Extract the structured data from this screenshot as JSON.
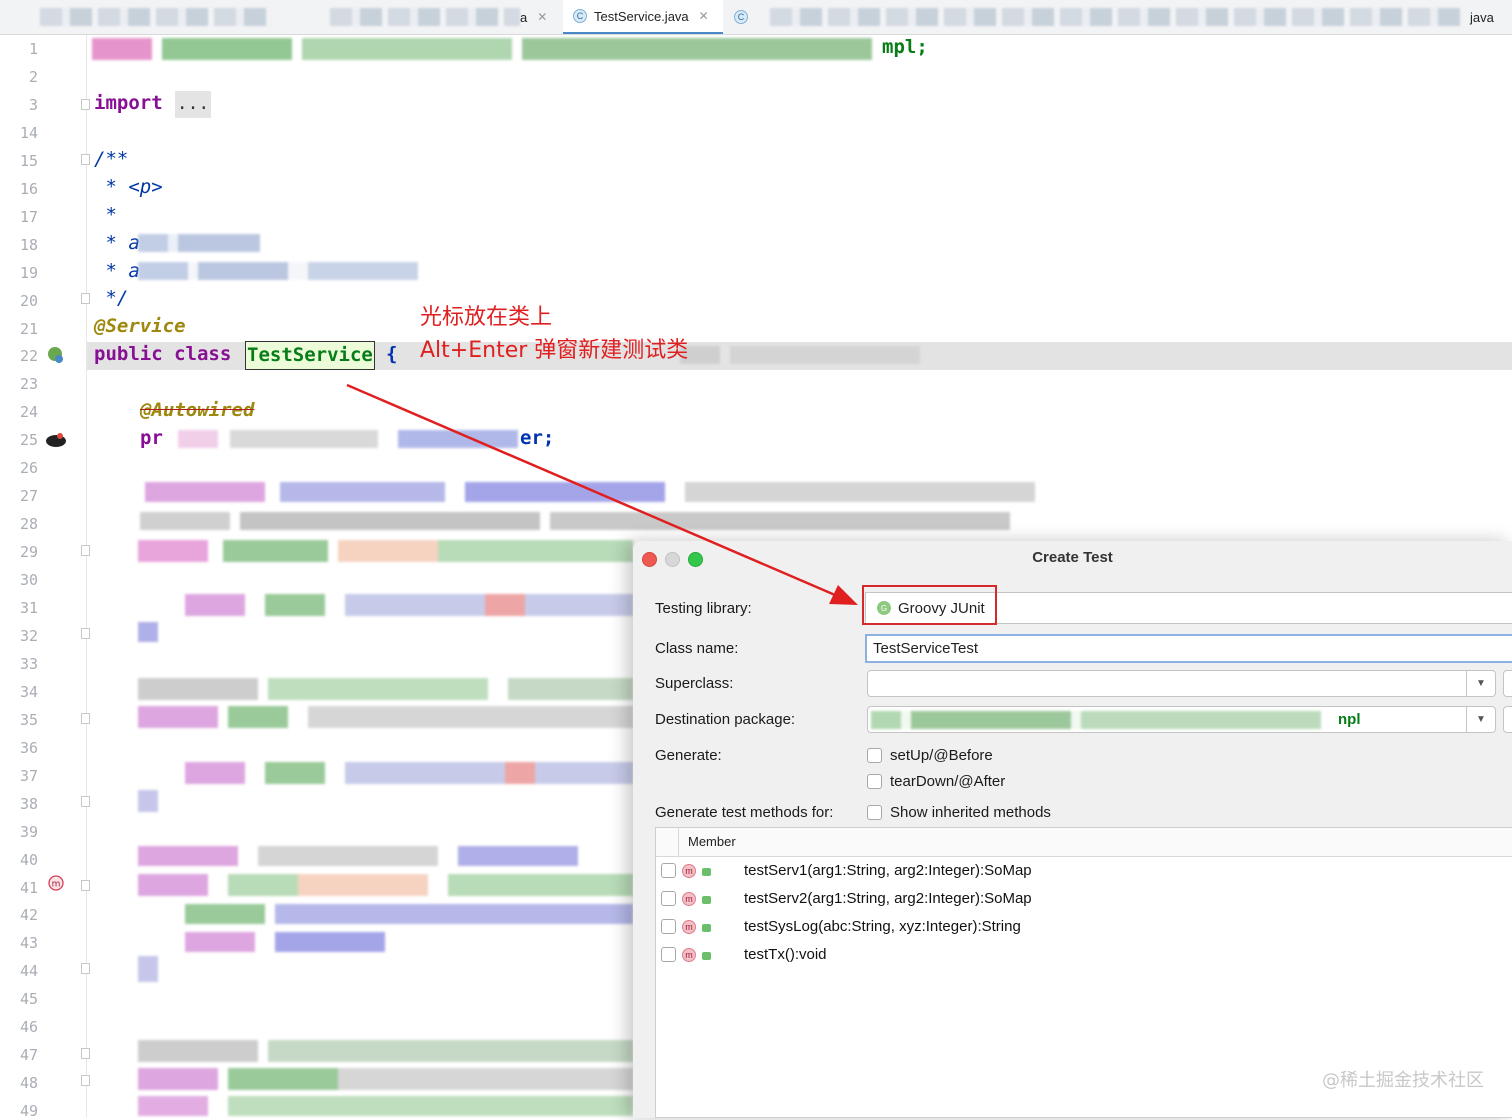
{
  "tabs": [
    {
      "label": "TestService.java",
      "icon": "class-icon",
      "active": true
    },
    {
      "label": "java",
      "icon": "class-icon",
      "active": false
    }
  ],
  "tab_fragment_left": "a",
  "line_numbers": [
    "1",
    "2",
    "3",
    "14",
    "15",
    "16",
    "17",
    "18",
    "19",
    "20",
    "21",
    "22",
    "23",
    "24",
    "25",
    "26",
    "27",
    "28",
    "29",
    "30",
    "31",
    "32",
    "33",
    "34",
    "35",
    "36",
    "37",
    "38",
    "39",
    "40",
    "41",
    "42",
    "43",
    "44",
    "45",
    "46",
    "47",
    "48",
    "49"
  ],
  "code": {
    "line1_tail": "mpl;",
    "import_kw": "import",
    "import_folded": "...",
    "doc_open": "/**",
    "doc_p_star": " * ",
    "doc_p_tag": "<p>",
    "doc_star": " *",
    "doc_star_a": " * a",
    "doc_close": " */",
    "annotation_service": "@Service",
    "decl_public": "public",
    "decl_class": "class",
    "class_name": "TestService",
    "brace": "{",
    "autowired": "@Autowired",
    "field_prefix": "pr",
    "field_suffix": "er;"
  },
  "notes": {
    "line1": "光标放在类上",
    "line2": "Alt+Enter 弹窗新建测试类"
  },
  "dialog": {
    "title": "Create Test",
    "testing_library_label": "Testing library:",
    "testing_library_value": "Groovy JUnit",
    "class_name_label": "Class name:",
    "class_name_value": "TestServiceTest",
    "superclass_label": "Superclass:",
    "superclass_value": "",
    "destination_label": "Destination package:",
    "destination_value_tail": "npl",
    "generate_label": "Generate:",
    "generate_options": [
      "setUp/@Before",
      "tearDown/@After"
    ],
    "methods_for_label": "Generate test methods for:",
    "show_inherited_label": "Show inherited methods",
    "member_header": "Member",
    "members": [
      "testServ1(arg1:String, arg2:Integer):SoMap",
      "testServ2(arg1:String, arg2:Integer):SoMap",
      "testSysLog(abc:String, xyz:Integer):String",
      "testTx():void"
    ]
  },
  "watermark": "@稀土掘金技术社区",
  "colors": {
    "annotation_red": "#e02020",
    "keyword": "#0033b3",
    "highlight_line": "#e3e3e3"
  }
}
